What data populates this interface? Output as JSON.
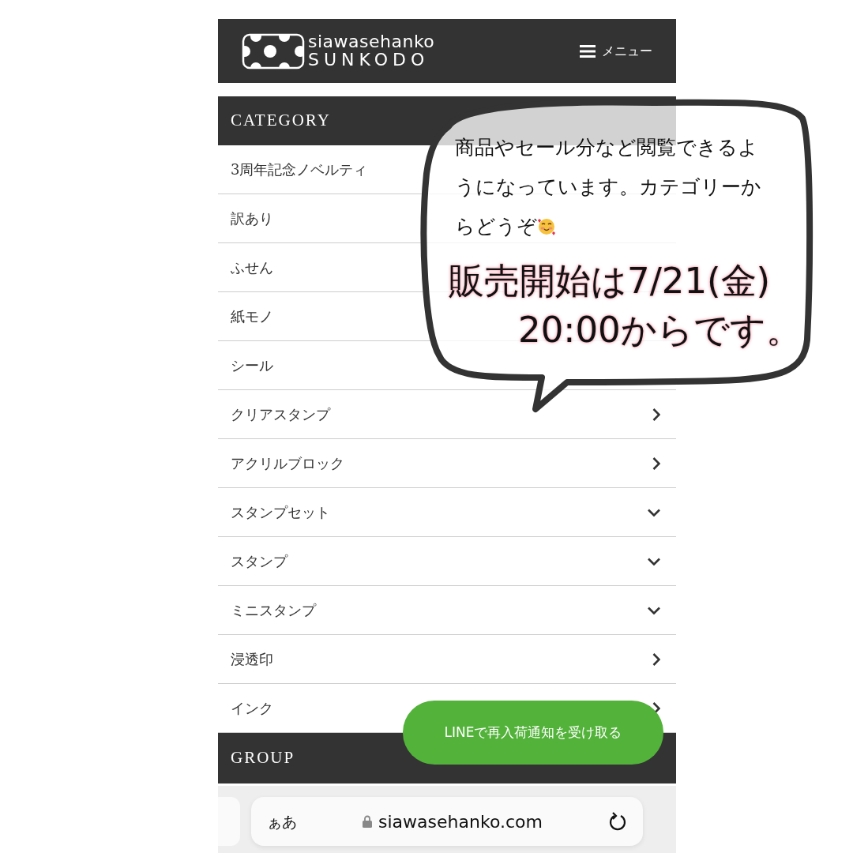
{
  "header": {
    "logo_line1": "siawasehanko",
    "logo_line2": "SUNKODO",
    "menu_label": "メニュー"
  },
  "category": {
    "title": "CATEGORY",
    "items": [
      {
        "label": "3周年記念ノベルティ"
      },
      {
        "label": "訳あり"
      },
      {
        "label": "ふせん"
      },
      {
        "label": "紙モノ"
      },
      {
        "label": "シール"
      },
      {
        "label": "クリアスタンプ",
        "kind": "right"
      },
      {
        "label": "アクリルブロック",
        "kind": "right"
      },
      {
        "label": "スタンプセット",
        "kind": "down"
      },
      {
        "label": "スタンプ",
        "kind": "down"
      },
      {
        "label": "ミニスタンプ",
        "kind": "down"
      },
      {
        "label": "浸透印",
        "kind": "right"
      },
      {
        "label": "インク",
        "kind": "right"
      }
    ]
  },
  "group": {
    "title": "GROUP"
  },
  "line_button": "LINEで再入荷通知を受け取る",
  "speech_bubble": {
    "text": "商品やセール分など閲覧できるようになっています。カテゴリーからどうぞ",
    "headline_1": "販売開始は7/21(金)",
    "headline_2": "20:00からです。"
  },
  "browser_bar": {
    "text_size_label": "ぁあ",
    "url": "siawasehanko.com"
  }
}
